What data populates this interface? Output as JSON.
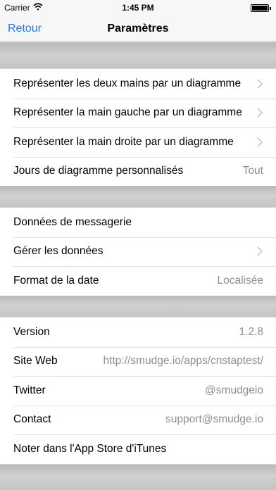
{
  "status_bar": {
    "carrier": "Carrier",
    "time": "1:45 PM"
  },
  "nav": {
    "back_label": "Retour",
    "title": "Paramètres"
  },
  "groups": [
    {
      "rows": [
        {
          "label": "Représenter les deux mains par un diagramme",
          "value": "",
          "chevron": true
        },
        {
          "label": "Représenter la main gauche par un diagramme",
          "value": "",
          "chevron": true
        },
        {
          "label": "Représenter la main droite par un diagramme",
          "value": "",
          "chevron": true
        },
        {
          "label": "Jours de diagramme personnalisés",
          "value": "Tout",
          "chevron": false
        }
      ]
    },
    {
      "rows": [
        {
          "label": "Données de messagerie",
          "value": "",
          "chevron": false
        },
        {
          "label": "Gérer les données",
          "value": "",
          "chevron": true
        },
        {
          "label": "Format de la date",
          "value": "Localisée",
          "chevron": false
        }
      ]
    },
    {
      "rows": [
        {
          "label": "Version",
          "value": "1.2.8",
          "chevron": false
        },
        {
          "label": "Site Web",
          "value": "http://smudge.io/apps/cnstaptest/",
          "chevron": false
        },
        {
          "label": "Twitter",
          "value": "@smudgeio",
          "chevron": false
        },
        {
          "label": "Contact",
          "value": "support@smudge.io",
          "chevron": false
        },
        {
          "label": "Noter dans l'App Store d'iTunes",
          "value": "",
          "chevron": false
        }
      ]
    }
  ]
}
